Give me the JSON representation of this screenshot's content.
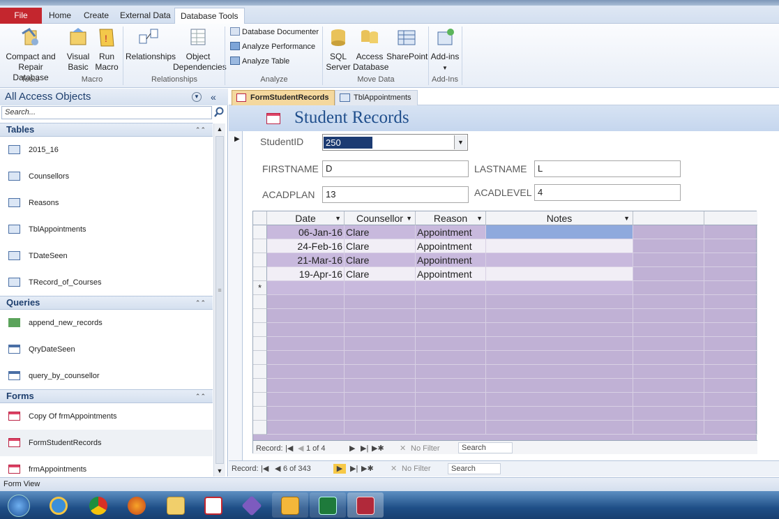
{
  "ribbon_tabs": [
    "File",
    "Home",
    "Create",
    "External Data",
    "Database Tools"
  ],
  "ribbon": {
    "compact": "Compact and\nRepair Database",
    "visual_basic": "Visual\nBasic",
    "run_macro": "Run\nMacro",
    "relationships": "Relationships",
    "object_dependencies": "Object\nDependencies",
    "db_documenter": "Database Documenter",
    "analyze_performance": "Analyze Performance",
    "analyze_table": "Analyze Table",
    "sql_server": "SQL\nServer",
    "access_database": "Access\nDatabase",
    "sharepoint": "SharePoint",
    "addins": "Add-ins",
    "groups": {
      "tools": "Tools",
      "macro": "Macro",
      "relationships": "Relationships",
      "analyze": "Analyze",
      "move_data": "Move Data",
      "addins": "Add-Ins"
    }
  },
  "nav": {
    "title": "All Access Objects",
    "search_placeholder": "Search...",
    "groups": [
      {
        "label": "Tables",
        "items": [
          "2015_16",
          "Counsellors",
          "Reasons",
          "TblAppointments",
          "TDateSeen",
          "TRecord_of_Courses"
        ]
      },
      {
        "label": "Queries",
        "items": [
          "append_new_records",
          "QryDateSeen",
          "query_by_counsellor"
        ]
      },
      {
        "label": "Forms",
        "items": [
          "Copy Of frmAppointments",
          "FormStudentRecords",
          "frmAppointments"
        ]
      }
    ]
  },
  "doc_tabs": [
    "FormStudentRecords",
    "TblAppointments"
  ],
  "form": {
    "title": "Student Records",
    "studentid_label": "StudentID",
    "studentid_value": "250",
    "firstname_label": "FIRSTNAME",
    "firstname_value": "D",
    "lastname_label": "LASTNAME",
    "lastname_value": "L",
    "acadplan_label": "ACADPLAN",
    "acadplan_value": "13",
    "acadlevel_label": "ACADLEVEL",
    "acadlevel_value": "4"
  },
  "subform": {
    "columns": [
      "Date",
      "Counsellor",
      "Reason",
      "Notes"
    ],
    "rows": [
      {
        "date": "06-Jan-16",
        "counsellor": "Clare",
        "reason": "Appointment",
        "notes": ""
      },
      {
        "date": "24-Feb-16",
        "counsellor": "Clare",
        "reason": "Appointment",
        "notes": ""
      },
      {
        "date": "21-Mar-16",
        "counsellor": "Clare",
        "reason": "Appointment",
        "notes": ""
      },
      {
        "date": "19-Apr-16",
        "counsellor": "Clare",
        "reason": "Appointment",
        "notes": ""
      }
    ],
    "new_row_marker": "*",
    "record_label": "Record:",
    "record_pos": "1 of 4",
    "filter": "No Filter",
    "search": "Search"
  },
  "main_nav": {
    "record_label": "Record:",
    "record_pos": "6 of 343",
    "filter": "No Filter",
    "search": "Search"
  },
  "status": "Form View",
  "colors": {
    "file_tab": "#c4262e",
    "accent": "#1f4e8c",
    "subform_bg": "#c0b1d5",
    "selected_row": "#8fa9dd"
  }
}
